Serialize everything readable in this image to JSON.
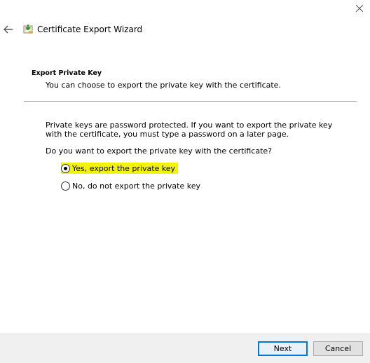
{
  "window": {
    "title": "Certificate Export Wizard",
    "close_icon": "close-icon",
    "back_icon": "back-arrow-icon",
    "app_icon": "certificate-icon"
  },
  "section": {
    "title": "Export Private Key",
    "subtitle": "You can choose to export the private key with the certificate."
  },
  "content": {
    "description": "Private keys are password protected. If you want to export the private key with the certificate, you must type a password on a later page.",
    "question": "Do you want to export the private key with the certificate?",
    "options": [
      {
        "label": "Yes, export the private key",
        "selected": true
      },
      {
        "label": "No, do not export the private key",
        "selected": false
      }
    ]
  },
  "buttons": {
    "next": "Next",
    "cancel": "Cancel"
  },
  "colors": {
    "highlight": "#f3f500",
    "focus_border": "#0078d7"
  }
}
